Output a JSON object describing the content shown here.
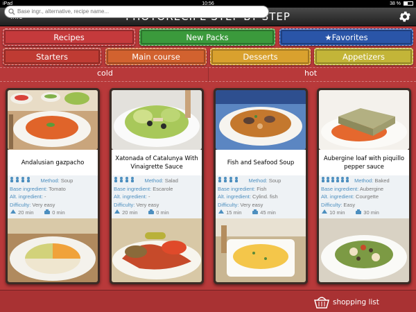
{
  "status": {
    "device": "iPad",
    "time": "10:56",
    "battery": "38 %"
  },
  "header": {
    "info_label": "Info",
    "title": "PHOTORECIPE STEP BY STEP"
  },
  "tabs_row1": [
    {
      "label": "Recipes",
      "color": "#c53a3c"
    },
    {
      "label": "New Packs",
      "color": "#3b9a3c"
    },
    {
      "label": "★Favorites",
      "color": "#2a55a8"
    }
  ],
  "tabs_row2": [
    {
      "label": "Starters",
      "color": "#bf3b33"
    },
    {
      "label": "Main course",
      "color": "#d2622f"
    },
    {
      "label": "Desserts",
      "color": "#d9a12e"
    },
    {
      "label": "Appetizers",
      "color": "#c3b538"
    }
  ],
  "sections": {
    "cold": "cold",
    "hot": "hot"
  },
  "labels": {
    "method": "Method:",
    "base": "Base ingredient:",
    "alt": "Alt. ingredient:",
    "difficulty": "Difficulty:"
  },
  "recipes": [
    {
      "name": "Andalusian gazpacho",
      "people": 4,
      "method": "Soup",
      "base": "Tomato",
      "alt": "-",
      "difficulty": "Very easy",
      "prep": "20 min",
      "cook": "0 min"
    },
    {
      "name": "Xatonada of Catalunya With Vinaigrette Sauce",
      "people": 4,
      "method": "Salad",
      "base": "Escarole",
      "alt": "-",
      "difficulty": "Very easy",
      "prep": "20 min",
      "cook": "0 min"
    },
    {
      "name": "Fish and Seafood Soup",
      "people": 4,
      "method": "Soup",
      "base": "Fish",
      "alt": "Cylind. fish",
      "difficulty": "Very easy",
      "prep": "15 min",
      "cook": "45 min"
    },
    {
      "name": "Aubergine loaf with piquillo pepper sauce",
      "people": 6,
      "method": "Baked",
      "base": "Aubergine",
      "alt": "Courgette",
      "difficulty": "Easy",
      "prep": "10 min",
      "cook": "30 min"
    }
  ],
  "search": {
    "placeholder": "Base ingr., alternative, recipe name..."
  },
  "shopping": {
    "label": "shopping list"
  }
}
